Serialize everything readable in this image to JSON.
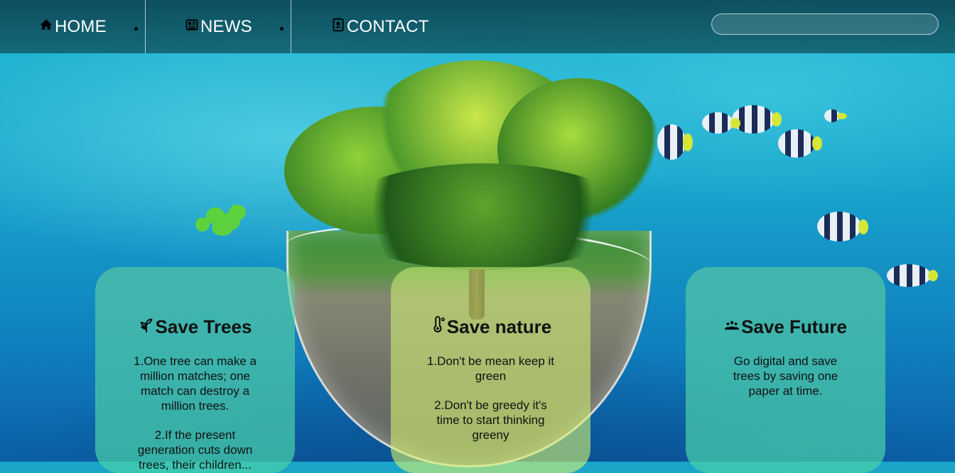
{
  "nav": {
    "items": [
      {
        "label": "HOME",
        "icon": "home-icon"
      },
      {
        "label": "NEWS",
        "icon": "newspaper-icon"
      },
      {
        "label": "CONTACT",
        "icon": "contact-card-icon"
      }
    ],
    "search_placeholder": ""
  },
  "cards": [
    {
      "title": "Save Trees",
      "icon": "seedling-icon",
      "paragraphs": [
        "1.One tree can make a million matches; one match can destroy a million trees.",
        "2.If the present generation cuts down trees, their children..."
      ]
    },
    {
      "title": "Save nature",
      "icon": "thermometer-icon",
      "paragraphs": [
        "1.Don't be mean keep it green",
        "2.Don't be greedy it's time to start thinking greeny"
      ]
    },
    {
      "title": "Save Future",
      "icon": "people-group-icon",
      "paragraphs": [
        "Go digital and save trees by saving one paper at time."
      ]
    }
  ],
  "colors": {
    "nav_bg": "#0f5866",
    "card_green": "#5fcda0",
    "card_lime": "#d2f078"
  }
}
